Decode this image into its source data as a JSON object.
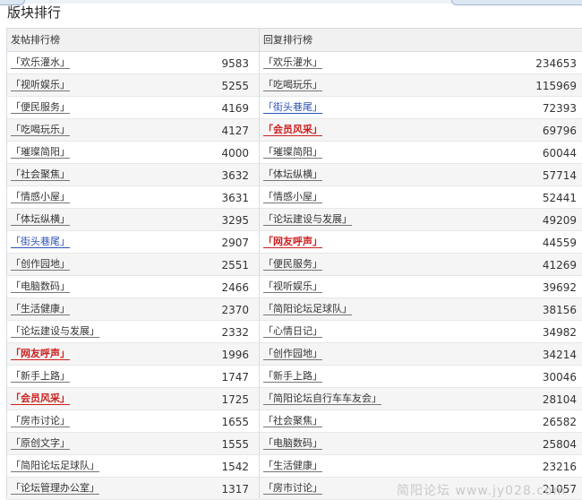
{
  "page": {
    "title": "版块排行"
  },
  "watermark": "简阳论坛 www.jy028.com",
  "left": {
    "header": "发帖排行榜",
    "rows": [
      {
        "name": "「欢乐灌水」",
        "count": "9583",
        "style": "normal"
      },
      {
        "name": "「视听娱乐」",
        "count": "5255",
        "style": "normal"
      },
      {
        "name": "「便民服务」",
        "count": "4169",
        "style": "normal"
      },
      {
        "name": "「吃喝玩乐」",
        "count": "4127",
        "style": "normal"
      },
      {
        "name": "「璀璨简阳」",
        "count": "4000",
        "style": "normal"
      },
      {
        "name": "「社会聚焦」",
        "count": "3632",
        "style": "normal"
      },
      {
        "name": "「情感小屋」",
        "count": "3631",
        "style": "normal"
      },
      {
        "name": "「体坛纵横」",
        "count": "3295",
        "style": "normal"
      },
      {
        "name": "「街头巷尾」",
        "count": "2907",
        "style": "blue"
      },
      {
        "name": "「创作园地」",
        "count": "2551",
        "style": "normal"
      },
      {
        "name": "「电脑数码」",
        "count": "2466",
        "style": "normal"
      },
      {
        "name": "「生活健康」",
        "count": "2370",
        "style": "normal"
      },
      {
        "name": "「论坛建设与发展」",
        "count": "2332",
        "style": "normal"
      },
      {
        "name": "「网友呼声」",
        "count": "1996",
        "style": "red"
      },
      {
        "name": "「新手上路」",
        "count": "1747",
        "style": "normal"
      },
      {
        "name": "「会员风采」",
        "count": "1725",
        "style": "red"
      },
      {
        "name": "「房市讨论」",
        "count": "1655",
        "style": "normal"
      },
      {
        "name": "「原创文字」",
        "count": "1555",
        "style": "normal"
      },
      {
        "name": "「简阳论坛足球队」",
        "count": "1542",
        "style": "normal"
      },
      {
        "name": "「论坛管理办公室」",
        "count": "1317",
        "style": "normal"
      }
    ]
  },
  "right": {
    "header": "回复排行榜",
    "rows": [
      {
        "name": "「欢乐灌水」",
        "count": "234653",
        "style": "normal"
      },
      {
        "name": "「吃喝玩乐」",
        "count": "115969",
        "style": "normal"
      },
      {
        "name": "「街头巷尾」",
        "count": "72393",
        "style": "blue"
      },
      {
        "name": "「会员风采」",
        "count": "69796",
        "style": "red"
      },
      {
        "name": "「璀璨简阳」",
        "count": "60044",
        "style": "normal"
      },
      {
        "name": "「体坛纵横」",
        "count": "57714",
        "style": "normal"
      },
      {
        "name": "「情感小屋」",
        "count": "52441",
        "style": "normal"
      },
      {
        "name": "「论坛建设与发展」",
        "count": "49209",
        "style": "normal"
      },
      {
        "name": "「网友呼声」",
        "count": "44559",
        "style": "red"
      },
      {
        "name": "「便民服务」",
        "count": "41269",
        "style": "normal"
      },
      {
        "name": "「视听娱乐」",
        "count": "39692",
        "style": "normal"
      },
      {
        "name": "「简阳论坛足球队」",
        "count": "38156",
        "style": "normal"
      },
      {
        "name": "「心情日记」",
        "count": "34982",
        "style": "normal"
      },
      {
        "name": "「创作园地」",
        "count": "34214",
        "style": "normal"
      },
      {
        "name": "「新手上路」",
        "count": "30046",
        "style": "normal"
      },
      {
        "name": "「简阳论坛自行车车友会」",
        "count": "28104",
        "style": "normal"
      },
      {
        "name": "「社会聚焦」",
        "count": "26582",
        "style": "normal"
      },
      {
        "name": "「电脑数码」",
        "count": "25804",
        "style": "normal"
      },
      {
        "name": "「生活健康」",
        "count": "23216",
        "style": "normal"
      },
      {
        "name": "「房市讨论」",
        "count": "21057",
        "style": "normal"
      }
    ]
  },
  "colors": {
    "link": "#333333",
    "highlight_blue": "#2a50b6",
    "highlight_red": "#cc1f1f",
    "header_bg": "#f1f1f1",
    "row_alt_bg": "#f5f5f5",
    "border": "#d7dde3"
  }
}
